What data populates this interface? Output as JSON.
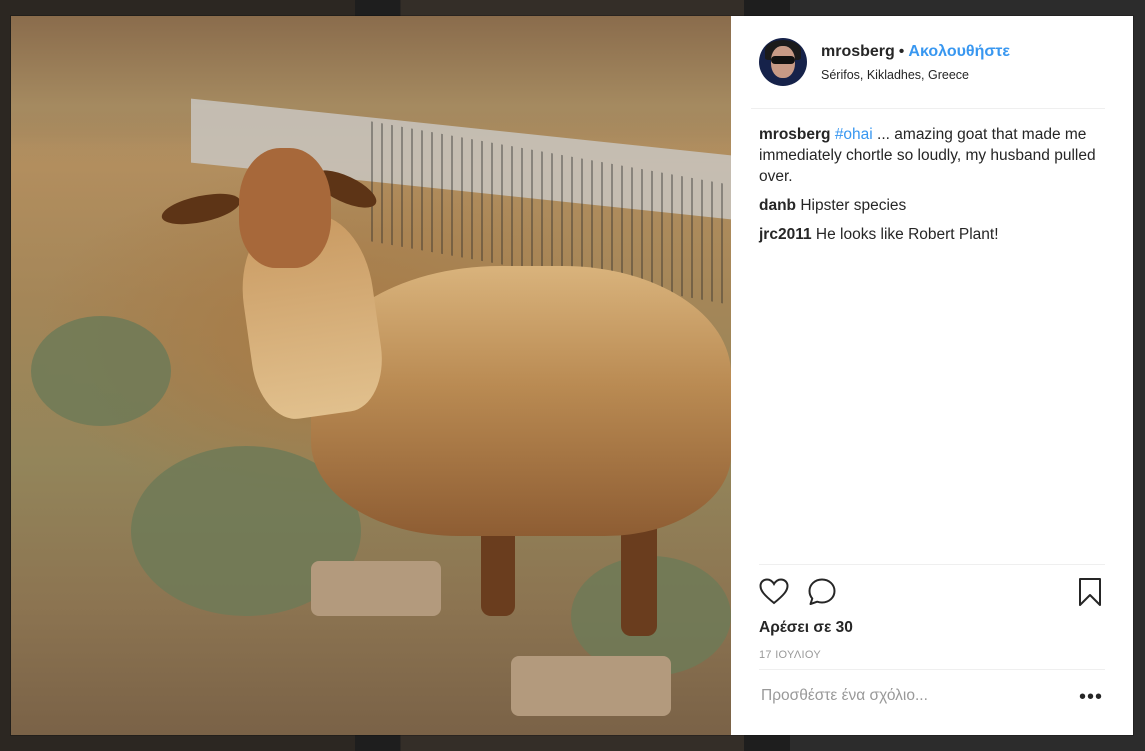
{
  "post": {
    "username": "mrosberg",
    "separator": "•",
    "follow_label": "Ακολουθήστε",
    "location": "Sérifos, Kikladhes, Greece"
  },
  "comments": [
    {
      "user": "mrosberg",
      "hashtag": "#ohai",
      "text": " ... amazing goat that made me immediately chortle so loudly, my husband pulled over."
    },
    {
      "user": "danb",
      "text": " Hipster species"
    },
    {
      "user": "jrc2011",
      "text": " He looks like Robert Plant!"
    }
  ],
  "actions": {
    "like_icon": "heart-icon",
    "comment_icon": "speech-bubble-icon",
    "save_icon": "bookmark-icon"
  },
  "likes_text": "Αρέσει σε 30",
  "date_text": "17 ΙΟΥΛΙΟΥ",
  "add_comment": {
    "placeholder": "Προσθέστε ένα σχόλιο...",
    "more_label": "•••"
  },
  "colors": {
    "link": "#3897f0",
    "text": "#262626",
    "muted": "#999999"
  }
}
